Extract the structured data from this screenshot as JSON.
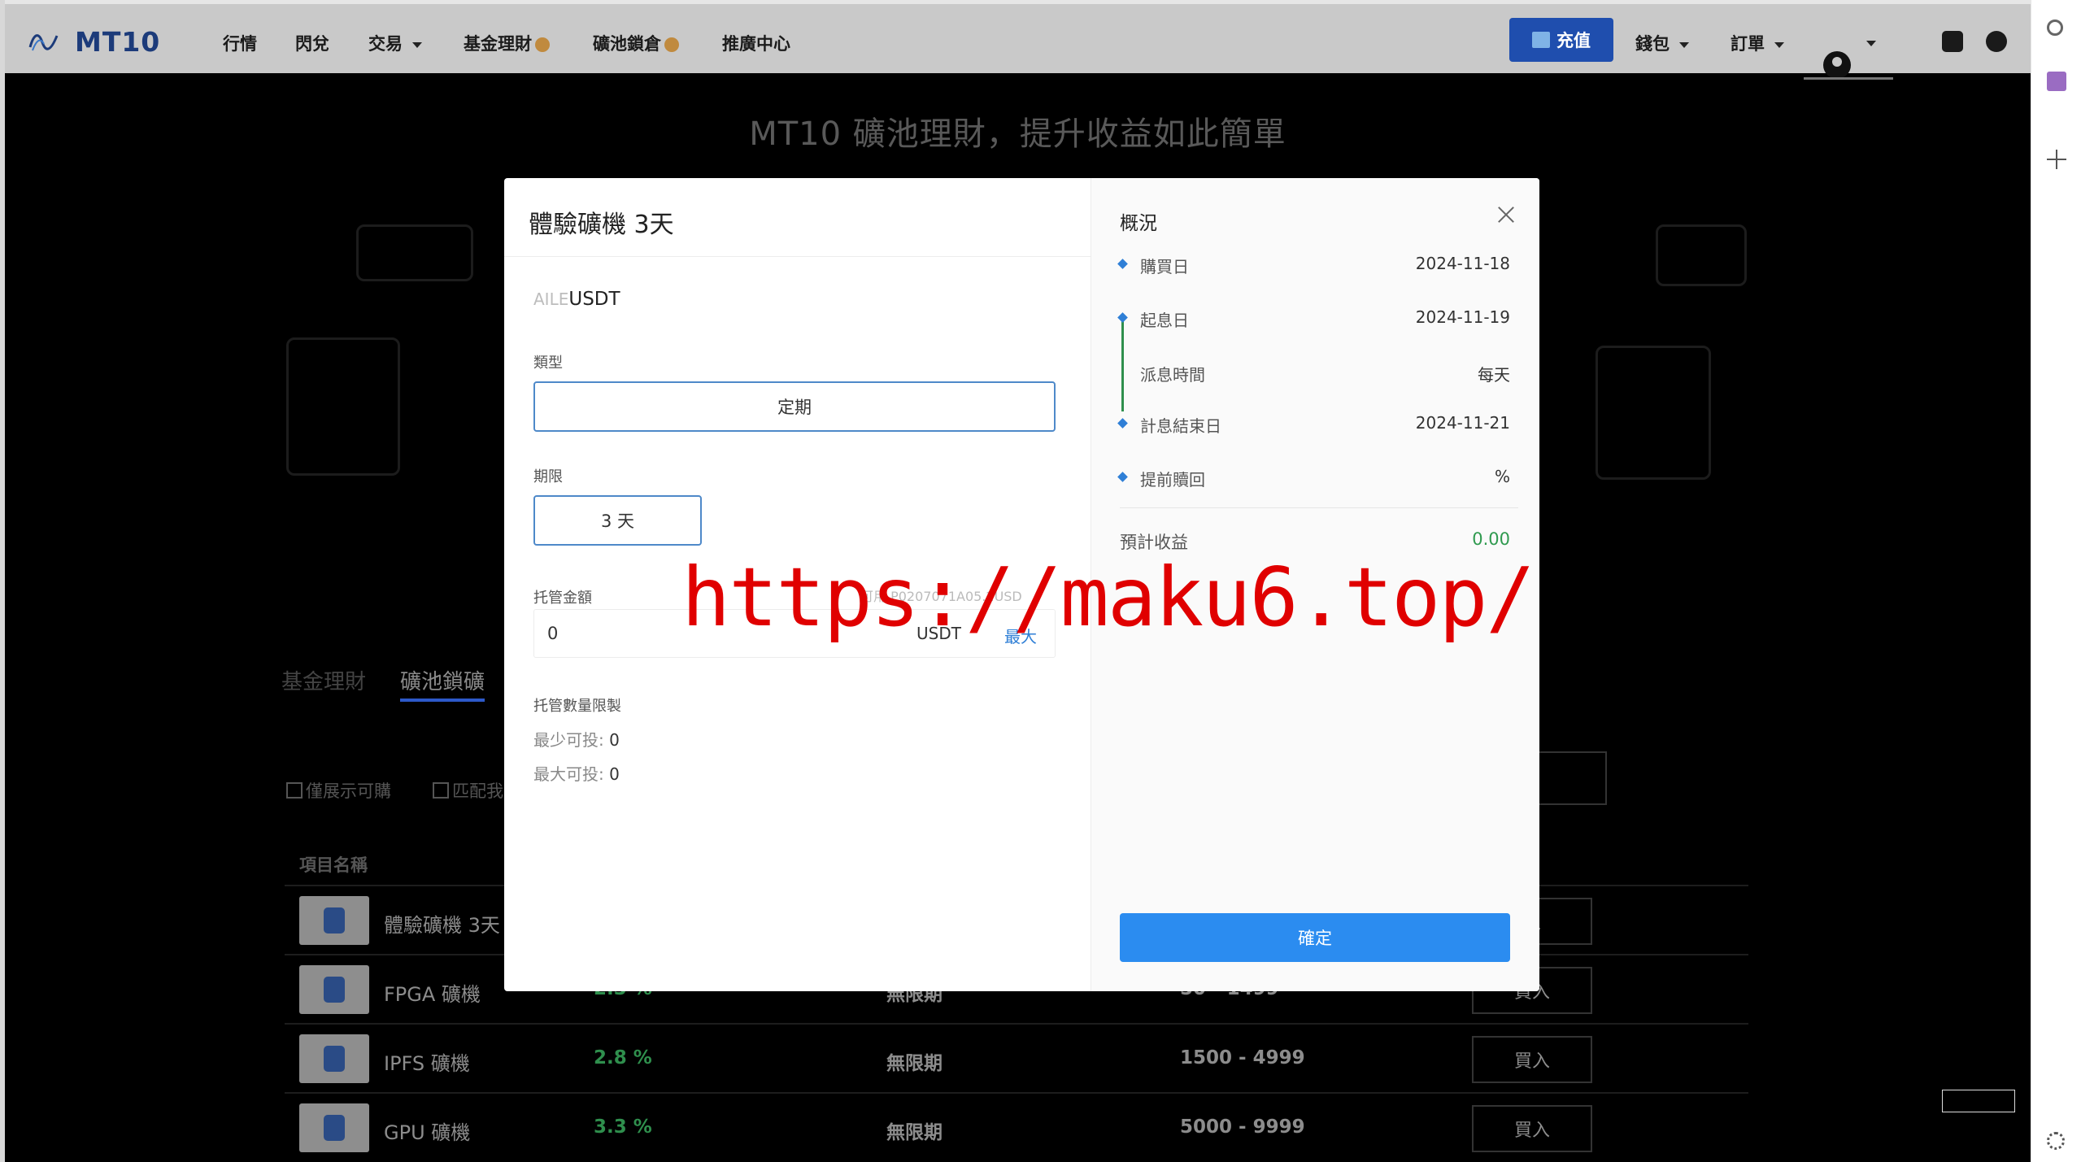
{
  "nav": {
    "brand": "MT10",
    "items": [
      "行情",
      "閃兌",
      "交易",
      "基金理財",
      "礦池鎖倉",
      "推廣中心"
    ],
    "recharge": "充值",
    "wallet": "錢包",
    "orders": "訂單"
  },
  "hero": {
    "title": "MT10 礦池理財，提升收益如此簡單"
  },
  "tabs": [
    "基金理財",
    "礦池鎖礦"
  ],
  "filters": [
    "僅展示可購",
    "匹配我"
  ],
  "table": {
    "header_name": "項目名稱",
    "rows": [
      {
        "name": "體驗礦機 3天",
        "rate": "",
        "term": "",
        "range": "",
        "buy": "入"
      },
      {
        "name": "FPGA 礦機",
        "rate": "2.3 %",
        "term": "無限期",
        "range": "50 - 1499",
        "buy": "買入"
      },
      {
        "name": "IPFS 礦機",
        "rate": "2.8 %",
        "term": "無限期",
        "range": "1500 - 4999",
        "buy": "買入"
      },
      {
        "name": "GPU 礦機",
        "rate": "3.3 %",
        "term": "無限期",
        "range": "5000 - 9999",
        "buy": "買入"
      }
    ]
  },
  "modal": {
    "title": "體驗礦機 3天",
    "coin_ghost": "AILE",
    "coin": "USDT",
    "type_label": "類型",
    "type_value": "定期",
    "term_label": "期限",
    "term_value": "3 天",
    "amount_label": "托管金額",
    "available": "可用 P0207071A05.2USD",
    "amount_value": "0",
    "amount_unit": "USDT",
    "max": "最大",
    "limit_title": "托管數量限製",
    "min_label": "最少可投:",
    "min_value": "0",
    "max_label": "最大可投:",
    "max_value": "0",
    "overview_title": "概況",
    "overview": [
      {
        "label": "購買日",
        "value": "2024-11-18"
      },
      {
        "label": "起息日",
        "value": "2024-11-19"
      },
      {
        "label": "派息時間",
        "value": "每天"
      },
      {
        "label": "計息結束日",
        "value": "2024-11-21"
      },
      {
        "label": "提前贖回",
        "value": "%"
      }
    ],
    "estimate_label": "預計收益",
    "estimate_value": "0.00",
    "confirm": "確定"
  },
  "watermark": "https://maku6.top/",
  "colors": {
    "accent": "#2b8cf0",
    "brand": "#1c3b7a",
    "positive": "#2f9a4f"
  }
}
